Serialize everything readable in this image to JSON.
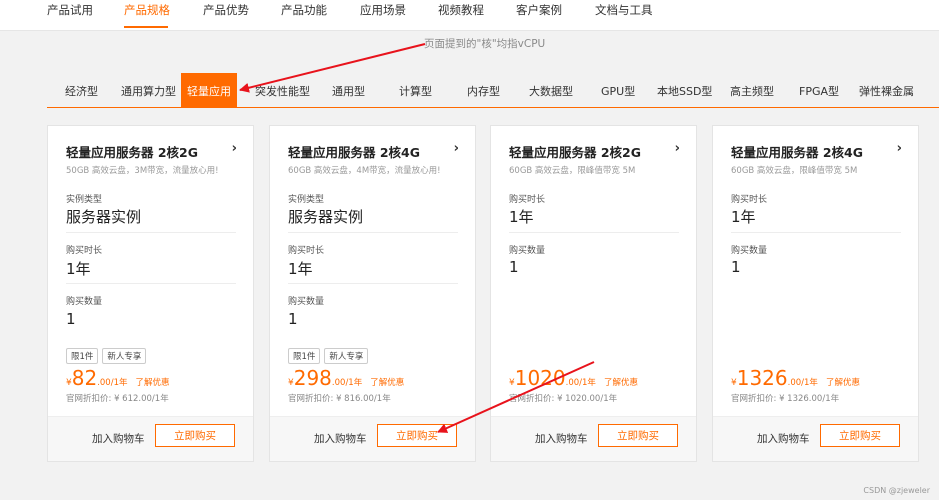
{
  "topnav": {
    "items": [
      "产品试用",
      "产品规格",
      "产品优势",
      "产品功能",
      "应用场景",
      "视频教程",
      "客户案例",
      "文档与工具"
    ],
    "active": 1
  },
  "annotation": "页面提到的\"核\"均指vCPU",
  "category_tabs": {
    "items": [
      "经济型",
      "通用算力型",
      "轻量应用",
      "突发性能型",
      "通用型",
      "计算型",
      "内存型",
      "大数据型",
      "GPU型",
      "本地SSD型",
      "高主频型",
      "FPGA型",
      "弹性裸金属"
    ],
    "active": 2
  },
  "cards": [
    {
      "title": "轻量应用服务器 2核2G",
      "desc": "50GB 高效云盘，3M带宽，流量放心用!",
      "fields": [
        {
          "label": "实例类型",
          "value": "服务器实例"
        },
        {
          "label": "购买时长",
          "value": "1年"
        },
        {
          "label": "购买数量",
          "value": "1"
        }
      ],
      "tags": [
        "限1件",
        "新人专享"
      ],
      "price": {
        "currency": "¥",
        "amount": "82",
        "unit": ".00/1年",
        "discount": "了解优惠"
      },
      "original": "官网折扣价: ¥ 612.00/1年",
      "cart": "加入购物车",
      "buy": "立即购买"
    },
    {
      "title": "轻量应用服务器 2核4G",
      "desc": "60GB 高效云盘，4M带宽，流量放心用!",
      "fields": [
        {
          "label": "实例类型",
          "value": "服务器实例"
        },
        {
          "label": "购买时长",
          "value": "1年"
        },
        {
          "label": "购买数量",
          "value": "1"
        }
      ],
      "tags": [
        "限1件",
        "新人专享"
      ],
      "price": {
        "currency": "¥",
        "amount": "298",
        "unit": ".00/1年",
        "discount": "了解优惠"
      },
      "original": "官网折扣价: ¥ 816.00/1年",
      "cart": "加入购物车",
      "buy": "立即购买"
    },
    {
      "title": "轻量应用服务器 2核2G",
      "desc": "60GB 高效云盘，限峰值带宽 5M",
      "fields": [
        {
          "label": "购买时长",
          "value": "1年"
        },
        {
          "label": "购买数量",
          "value": "1"
        }
      ],
      "tags": [],
      "price": {
        "currency": "¥",
        "amount": "1020",
        "unit": ".00/1年",
        "discount": "了解优惠"
      },
      "original": "官网折扣价: ¥ 1020.00/1年",
      "cart": "加入购物车",
      "buy": "立即购买"
    },
    {
      "title": "轻量应用服务器 2核4G",
      "desc": "60GB 高效云盘，限峰值带宽 5M",
      "fields": [
        {
          "label": "购买时长",
          "value": "1年"
        },
        {
          "label": "购买数量",
          "value": "1"
        }
      ],
      "tags": [],
      "price": {
        "currency": "¥",
        "amount": "1326",
        "unit": ".00/1年",
        "discount": "了解优惠"
      },
      "original": "官网折扣价: ¥ 1326.00/1年",
      "cart": "加入购物车",
      "buy": "立即购买"
    }
  ],
  "watermark": "CSDN @zjeweler",
  "colors": {
    "accent": "#ff6a00",
    "arrow": "#e8131c"
  }
}
